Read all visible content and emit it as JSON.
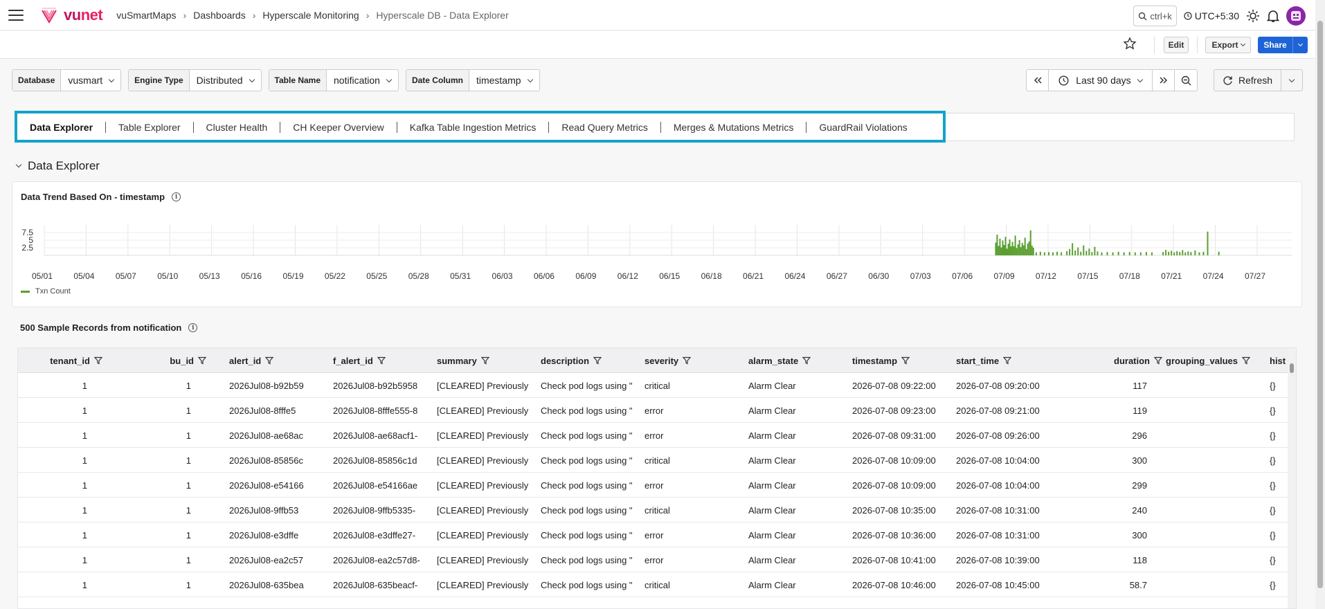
{
  "header": {
    "brand": "vunet",
    "breadcrumb": [
      "vuSmartMaps",
      "Dashboards",
      "Hyperscale Monitoring",
      "Hyperscale DB - Data Explorer"
    ],
    "search_placeholder": "ctrl+k",
    "timezone": "UTC+5:30"
  },
  "actions": {
    "edit": "Edit",
    "export": "Export",
    "share": "Share"
  },
  "filters": [
    {
      "label": "Database",
      "value": "vusmart"
    },
    {
      "label": "Engine Type",
      "value": "Distributed"
    },
    {
      "label": "Table Name",
      "value": "notification"
    },
    {
      "label": "Date Column",
      "value": "timestamp"
    }
  ],
  "time": {
    "range": "Last 90 days",
    "refresh": "Refresh"
  },
  "tabs": [
    "Data Explorer",
    "Table Explorer",
    "Cluster Health",
    "CH Keeper Overview",
    "Kafka Table Ingestion Metrics",
    "Read Query Metrics",
    "Merges & Mutations Metrics",
    "GuardRail Violations"
  ],
  "section": {
    "title": "Data Explorer"
  },
  "chart_card": {
    "title": "Data Trend Based On - timestamp"
  },
  "chart_data": {
    "type": "bar",
    "ylim": [
      0,
      10
    ],
    "yticks": [
      "2.5",
      "5",
      "7.5"
    ],
    "xticks": [
      "05/01",
      "05/04",
      "05/07",
      "05/10",
      "05/13",
      "05/16",
      "05/19",
      "05/22",
      "05/25",
      "05/28",
      "05/31",
      "06/03",
      "06/06",
      "06/09",
      "06/12",
      "06/15",
      "06/18",
      "06/21",
      "06/24",
      "06/27",
      "06/30",
      "07/03",
      "07/06",
      "07/09",
      "07/12",
      "07/15",
      "07/18",
      "07/21",
      "07/24",
      "07/27"
    ],
    "series": [
      {
        "name": "Txn Count",
        "color": "#5a9e2f"
      }
    ],
    "bars": [
      {
        "day": 68.2,
        "value": 4.2
      },
      {
        "day": 68.3,
        "value": 6.8
      },
      {
        "day": 68.4,
        "value": 3.1
      },
      {
        "day": 68.5,
        "value": 5.5
      },
      {
        "day": 68.6,
        "value": 2.6
      },
      {
        "day": 68.7,
        "value": 4.9
      },
      {
        "day": 68.8,
        "value": 3.4
      },
      {
        "day": 68.9,
        "value": 6.1
      },
      {
        "day": 69.0,
        "value": 2.2
      },
      {
        "day": 69.1,
        "value": 3.8
      },
      {
        "day": 69.2,
        "value": 5.2
      },
      {
        "day": 69.3,
        "value": 2.9
      },
      {
        "day": 69.4,
        "value": 4.4
      },
      {
        "day": 69.5,
        "value": 3.0
      },
      {
        "day": 69.6,
        "value": 6.5
      },
      {
        "day": 69.7,
        "value": 2.4
      },
      {
        "day": 69.8,
        "value": 3.6
      },
      {
        "day": 69.9,
        "value": 5.0
      },
      {
        "day": 70.0,
        "value": 2.7
      },
      {
        "day": 70.1,
        "value": 4.1
      },
      {
        "day": 70.2,
        "value": 3.3
      },
      {
        "day": 70.3,
        "value": 5.8
      },
      {
        "day": 70.4,
        "value": 2.1
      },
      {
        "day": 70.5,
        "value": 3.9
      },
      {
        "day": 70.6,
        "value": 4.6
      },
      {
        "day": 70.7,
        "value": 8.2
      },
      {
        "day": 70.8,
        "value": 3.2
      },
      {
        "day": 70.9,
        "value": 2.5
      },
      {
        "day": 71.1,
        "value": 1.0
      },
      {
        "day": 71.4,
        "value": 1.2
      },
      {
        "day": 71.7,
        "value": 1.0
      },
      {
        "day": 72.0,
        "value": 1.1
      },
      {
        "day": 72.3,
        "value": 1.0
      },
      {
        "day": 72.6,
        "value": 1.2
      },
      {
        "day": 72.9,
        "value": 1.0
      },
      {
        "day": 73.3,
        "value": 1.4
      },
      {
        "day": 73.5,
        "value": 2.1
      },
      {
        "day": 73.7,
        "value": 4.0
      },
      {
        "day": 73.9,
        "value": 1.6
      },
      {
        "day": 74.1,
        "value": 2.6
      },
      {
        "day": 74.3,
        "value": 1.2
      },
      {
        "day": 74.5,
        "value": 3.3
      },
      {
        "day": 74.7,
        "value": 1.5
      },
      {
        "day": 74.9,
        "value": 2.2
      },
      {
        "day": 75.1,
        "value": 1.1
      },
      {
        "day": 75.3,
        "value": 2.8
      },
      {
        "day": 75.5,
        "value": 1.3
      },
      {
        "day": 75.8,
        "value": 1.0
      },
      {
        "day": 76.2,
        "value": 1.1
      },
      {
        "day": 76.6,
        "value": 1.0
      },
      {
        "day": 77.0,
        "value": 1.2
      },
      {
        "day": 77.4,
        "value": 1.0
      },
      {
        "day": 77.8,
        "value": 1.1
      },
      {
        "day": 78.2,
        "value": 1.0
      },
      {
        "day": 78.6,
        "value": 1.0
      },
      {
        "day": 79.0,
        "value": 1.1
      },
      {
        "day": 79.4,
        "value": 1.0
      },
      {
        "day": 80.2,
        "value": 1.1
      },
      {
        "day": 80.4,
        "value": 1.8
      },
      {
        "day": 80.6,
        "value": 1.2
      },
      {
        "day": 80.8,
        "value": 1.5
      },
      {
        "day": 81.0,
        "value": 1.0
      },
      {
        "day": 81.2,
        "value": 1.4
      },
      {
        "day": 81.4,
        "value": 1.1
      },
      {
        "day": 81.6,
        "value": 1.7
      },
      {
        "day": 81.8,
        "value": 1.0
      },
      {
        "day": 82.0,
        "value": 1.3
      },
      {
        "day": 82.2,
        "value": 1.1
      },
      {
        "day": 82.5,
        "value": 1.6
      },
      {
        "day": 82.8,
        "value": 1.0
      },
      {
        "day": 83.1,
        "value": 1.2
      },
      {
        "day": 83.4,
        "value": 7.8
      },
      {
        "day": 84.2,
        "value": 1.2
      }
    ]
  },
  "table": {
    "title": "500 Sample Records from notification",
    "columns": [
      "tenant_id",
      "bu_id",
      "alert_id",
      "f_alert_id",
      "summary",
      "description",
      "severity",
      "alarm_state",
      "timestamp",
      "start_time",
      "duration",
      "grouping_values",
      "hist"
    ],
    "rows": [
      [
        "1",
        "1",
        "2026Jul08-b92b59",
        "2026Jul08-b92b5958",
        "[CLEARED] Previously",
        "Check pod logs using \"",
        "critical",
        "Alarm Clear",
        "2026-07-08 09:22:00",
        "2026-07-08 09:20:00",
        "117",
        "",
        "{}"
      ],
      [
        "1",
        "1",
        "2026Jul08-8fffe5",
        "2026Jul08-8fffe555-8",
        "[CLEARED] Previously",
        "Check pod logs using \"",
        "error",
        "Alarm Clear",
        "2026-07-08 09:23:00",
        "2026-07-08 09:21:00",
        "119",
        "",
        "{}"
      ],
      [
        "1",
        "1",
        "2026Jul08-ae68ac",
        "2026Jul08-ae68acf1-",
        "[CLEARED] Previously",
        "Check pod logs using \"",
        "error",
        "Alarm Clear",
        "2026-07-08 09:31:00",
        "2026-07-08 09:26:00",
        "296",
        "",
        "{}"
      ],
      [
        "1",
        "1",
        "2026Jul08-85856c",
        "2026Jul08-85856c1d",
        "[CLEARED] Previously",
        "Check pod logs using \"",
        "critical",
        "Alarm Clear",
        "2026-07-08 10:09:00",
        "2026-07-08 10:04:00",
        "300",
        "",
        "{}"
      ],
      [
        "1",
        "1",
        "2026Jul08-e54166",
        "2026Jul08-e54166ae",
        "[CLEARED] Previously",
        "Check pod logs using \"",
        "error",
        "Alarm Clear",
        "2026-07-08 10:09:00",
        "2026-07-08 10:04:00",
        "299",
        "",
        "{}"
      ],
      [
        "1",
        "1",
        "2026Jul08-9ffb53",
        "2026Jul08-9ffb5335-",
        "[CLEARED] Previously",
        "Check pod logs using \"",
        "critical",
        "Alarm Clear",
        "2026-07-08 10:35:00",
        "2026-07-08 10:31:00",
        "240",
        "",
        "{}"
      ],
      [
        "1",
        "1",
        "2026Jul08-e3dffe",
        "2026Jul08-e3dffe27-",
        "[CLEARED] Previously",
        "Check pod logs using \"",
        "error",
        "Alarm Clear",
        "2026-07-08 10:36:00",
        "2026-07-08 10:31:00",
        "300",
        "",
        "{}"
      ],
      [
        "1",
        "1",
        "2026Jul08-ea2c57",
        "2026Jul08-ea2c57d8-",
        "[CLEARED] Previously",
        "Check pod logs using \"",
        "error",
        "Alarm Clear",
        "2026-07-08 10:41:00",
        "2026-07-08 10:39:00",
        "118",
        "",
        "{}"
      ],
      [
        "1",
        "1",
        "2026Jul08-635bea",
        "2026Jul08-635beacf-",
        "[CLEARED] Previously",
        "Check pod logs using \"",
        "critical",
        "Alarm Clear",
        "2026-07-08 10:46:00",
        "2026-07-08 10:45:00",
        "58.7",
        "",
        "{}"
      ]
    ]
  }
}
